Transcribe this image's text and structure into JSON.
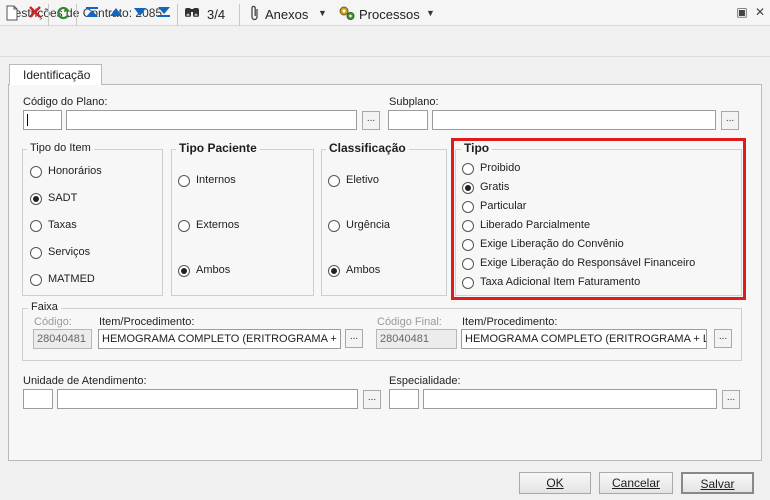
{
  "window": {
    "title": "Restrições de Contrato: 2085",
    "restore_glyph": "▣",
    "close_glyph": "✕"
  },
  "toolbar": {
    "record_position": "3/4",
    "anexos_label": "Anexos",
    "processos_label": "Processos"
  },
  "tabs": [
    {
      "label": "Identificação"
    }
  ],
  "fields": {
    "codigo_plano_label": "Código do Plano:",
    "subplano_label": "Subplano:",
    "unidade_label": "Unidade de Atendimento:",
    "especialidade_label": "Especialidade:"
  },
  "tipo_item": {
    "title": "Tipo do Item",
    "options": [
      "Honorários",
      "SADT",
      "Taxas",
      "Serviços",
      "MATMED"
    ],
    "selected": "SADT"
  },
  "tipo_paciente": {
    "title": "Tipo Paciente",
    "options": [
      "Internos",
      "Externos",
      "Ambos"
    ],
    "selected": "Ambos"
  },
  "classificacao": {
    "title": "Classificação",
    "options": [
      "Eletivo",
      "Urgência",
      "Ambos"
    ],
    "selected": "Ambos"
  },
  "tipo": {
    "title": "Tipo",
    "options": [
      "Proibido",
      "Gratis",
      "Particular",
      "Liberado Parcialmente",
      "Exige Liberação do Convênio",
      "Exige Liberação do Responsável Financeiro",
      "Taxa Adicional Item Faturamento"
    ],
    "selected": "Gratis"
  },
  "faixa": {
    "title": "Faixa",
    "codigo_label": "Código:",
    "codigo_value": "28040481",
    "item_label": "Item/Procedimento:",
    "item_value": "HEMOGRAMA COMPLETO (ERITROGRAMA + LE",
    "codigo_final_label": "Código Final:",
    "codigo_final_value": "28040481",
    "item_final_label": "Item/Procedimento:",
    "item_final_value": "HEMOGRAMA COMPLETO (ERITROGRAMA + LE"
  },
  "buttons": {
    "ok": "OK",
    "cancelar": "Cancelar",
    "salvar": "Salvar"
  },
  "colors": {
    "highlight": "#e01b1b",
    "accent_blue": "#1565c0"
  }
}
